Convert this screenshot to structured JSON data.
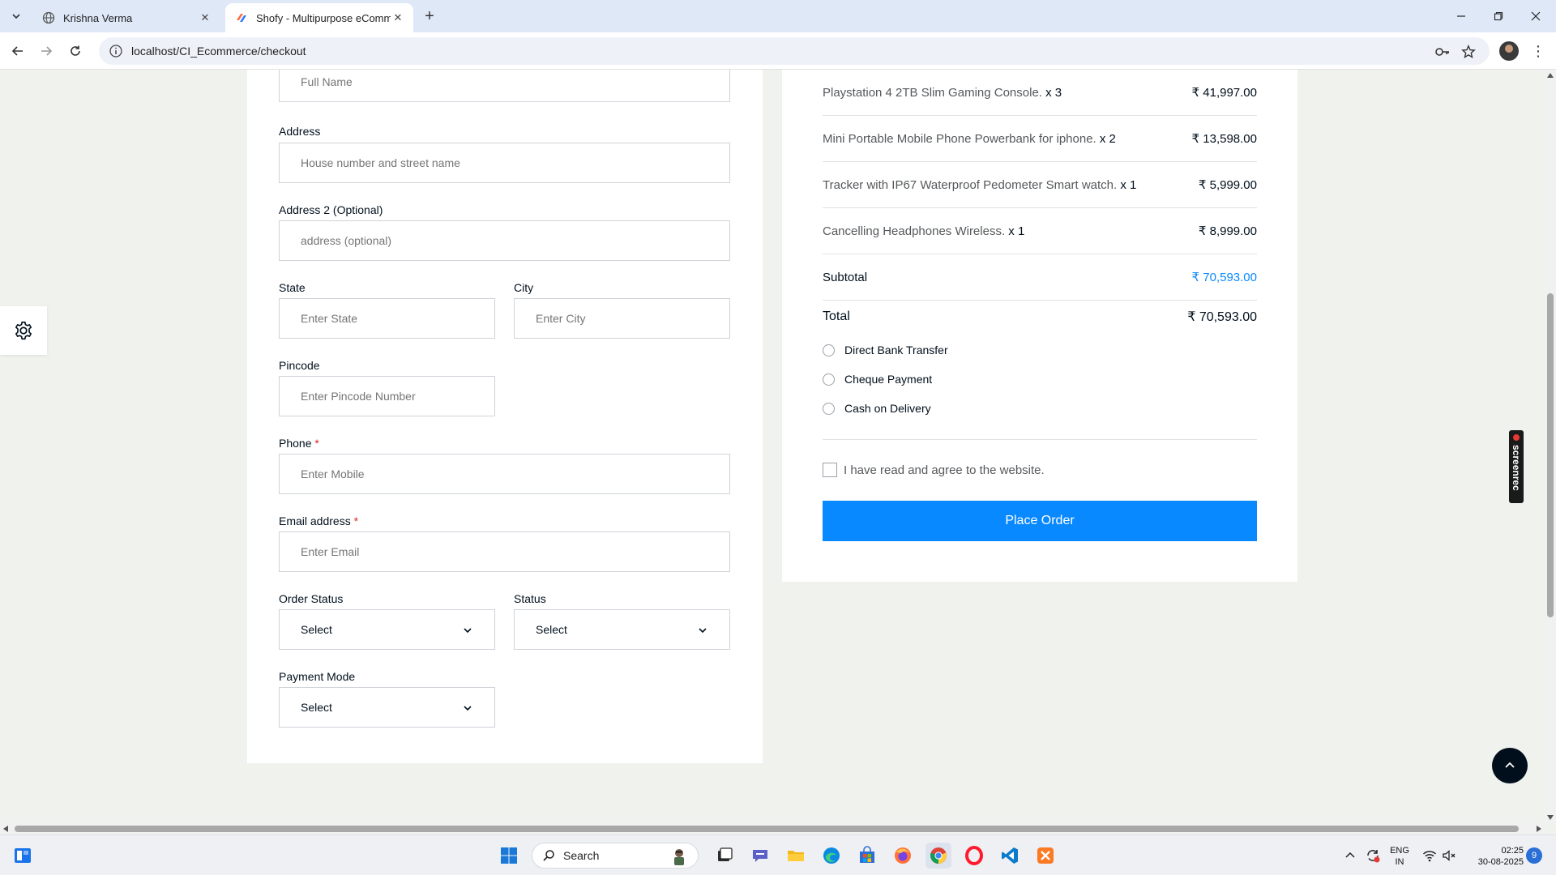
{
  "browser": {
    "tabs": [
      {
        "title": "Krishna Verma",
        "active": false
      },
      {
        "title": "Shofy - Multipurpose eCommerce",
        "active": true
      }
    ],
    "url": "localhost/CI_Ecommerce/checkout"
  },
  "form": {
    "full_name": {
      "placeholder": "Full Name"
    },
    "address": {
      "label": "Address",
      "placeholder": "House number and street name"
    },
    "address2": {
      "label": "Address 2 (Optional)",
      "placeholder": "address (optional)"
    },
    "state": {
      "label": "State",
      "placeholder": "Enter State"
    },
    "city": {
      "label": "City",
      "placeholder": "Enter City"
    },
    "pincode": {
      "label": "Pincode",
      "placeholder": "Enter Pincode Number"
    },
    "phone": {
      "label": "Phone",
      "required_mark": "*",
      "placeholder": "Enter Mobile"
    },
    "email": {
      "label": "Email address",
      "required_mark": "*",
      "placeholder": "Enter Email"
    },
    "order_status": {
      "label": "Order Status",
      "value": "Select"
    },
    "status": {
      "label": "Status",
      "value": "Select"
    },
    "payment_mode": {
      "label": "Payment Mode",
      "value": "Select"
    }
  },
  "order": {
    "items": [
      {
        "name": "Playstation 4 2TB Slim Gaming Console.",
        "qty": "x 3",
        "price": "₹ 41,997.00"
      },
      {
        "name": "Mini Portable Mobile Phone Powerbank for iphone.",
        "qty": "x 2",
        "price": "₹ 13,598.00"
      },
      {
        "name": "Tracker with IP67 Waterproof Pedometer Smart watch.",
        "qty": "x 1",
        "price": "₹ 5,999.00"
      },
      {
        "name": "Cancelling Headphones Wireless.",
        "qty": "x 1",
        "price": "₹ 8,999.00"
      }
    ],
    "subtotal_label": "Subtotal",
    "subtotal_value": "₹ 70,593.00",
    "total_label": "Total",
    "total_value": "₹ 70,593.00",
    "payment_options": [
      "Direct Bank Transfer",
      "Cheque Payment",
      "Cash on Delivery"
    ],
    "agree_text": "I have read and agree to the website.",
    "place_order_label": "Place Order"
  },
  "overlay": {
    "screenrec_label": "screenrec"
  },
  "taskbar": {
    "search_label": "Search",
    "lang_line1": "ENG",
    "lang_line2": "IN",
    "time": "02:25",
    "date": "30-08-2025",
    "notification_count": "9"
  },
  "colors": {
    "accent": "#0989ff",
    "dark": "#010f1c",
    "required": "#e02525"
  }
}
